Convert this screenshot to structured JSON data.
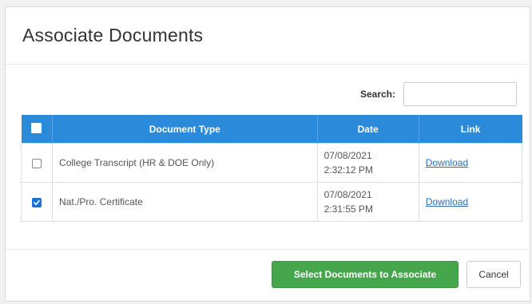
{
  "dialog": {
    "title": "Associate Documents"
  },
  "search": {
    "label": "Search:",
    "value": "",
    "placeholder": ""
  },
  "table": {
    "header_checkbox_checked": false,
    "columns": [
      "Document Type",
      "Date",
      "Link"
    ],
    "rows": [
      {
        "checked": false,
        "document_type": "College Transcript (HR & DOE Only)",
        "date": "07/08/2021",
        "time": "2:32:12 PM",
        "link": "Download"
      },
      {
        "checked": true,
        "document_type": "Nat./Pro. Certificate",
        "date": "07/08/2021",
        "time": "2:31:55 PM",
        "link": "Download"
      }
    ]
  },
  "footer": {
    "primary_label": "Select Documents to Associate",
    "cancel_label": "Cancel"
  },
  "colors": {
    "header_blue": "#2b8ad9",
    "primary_green": "#46a64b",
    "link_blue": "#2a6fb8",
    "checkbox_blue": "#1f73d6"
  }
}
